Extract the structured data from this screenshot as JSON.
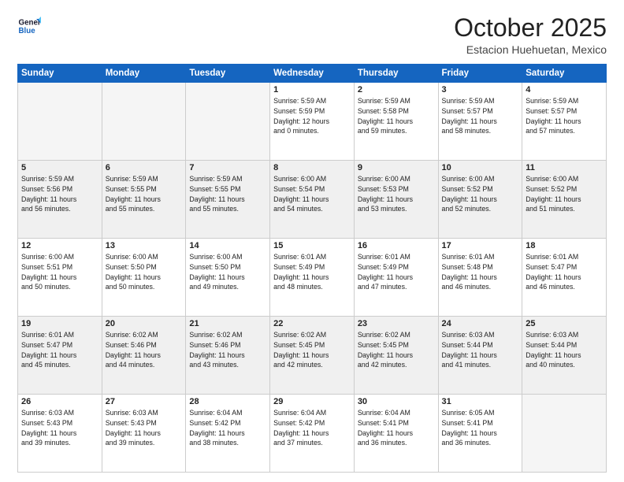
{
  "logo": {
    "line1": "General",
    "line2": "Blue"
  },
  "header": {
    "month": "October 2025",
    "location": "Estacion Huehuetan, Mexico"
  },
  "weekdays": [
    "Sunday",
    "Monday",
    "Tuesday",
    "Wednesday",
    "Thursday",
    "Friday",
    "Saturday"
  ],
  "weeks": [
    [
      {
        "day": "",
        "info": ""
      },
      {
        "day": "",
        "info": ""
      },
      {
        "day": "",
        "info": ""
      },
      {
        "day": "1",
        "info": "Sunrise: 5:59 AM\nSunset: 5:59 PM\nDaylight: 12 hours\nand 0 minutes."
      },
      {
        "day": "2",
        "info": "Sunrise: 5:59 AM\nSunset: 5:58 PM\nDaylight: 11 hours\nand 59 minutes."
      },
      {
        "day": "3",
        "info": "Sunrise: 5:59 AM\nSunset: 5:57 PM\nDaylight: 11 hours\nand 58 minutes."
      },
      {
        "day": "4",
        "info": "Sunrise: 5:59 AM\nSunset: 5:57 PM\nDaylight: 11 hours\nand 57 minutes."
      }
    ],
    [
      {
        "day": "5",
        "info": "Sunrise: 5:59 AM\nSunset: 5:56 PM\nDaylight: 11 hours\nand 56 minutes."
      },
      {
        "day": "6",
        "info": "Sunrise: 5:59 AM\nSunset: 5:55 PM\nDaylight: 11 hours\nand 55 minutes."
      },
      {
        "day": "7",
        "info": "Sunrise: 5:59 AM\nSunset: 5:55 PM\nDaylight: 11 hours\nand 55 minutes."
      },
      {
        "day": "8",
        "info": "Sunrise: 6:00 AM\nSunset: 5:54 PM\nDaylight: 11 hours\nand 54 minutes."
      },
      {
        "day": "9",
        "info": "Sunrise: 6:00 AM\nSunset: 5:53 PM\nDaylight: 11 hours\nand 53 minutes."
      },
      {
        "day": "10",
        "info": "Sunrise: 6:00 AM\nSunset: 5:52 PM\nDaylight: 11 hours\nand 52 minutes."
      },
      {
        "day": "11",
        "info": "Sunrise: 6:00 AM\nSunset: 5:52 PM\nDaylight: 11 hours\nand 51 minutes."
      }
    ],
    [
      {
        "day": "12",
        "info": "Sunrise: 6:00 AM\nSunset: 5:51 PM\nDaylight: 11 hours\nand 50 minutes."
      },
      {
        "day": "13",
        "info": "Sunrise: 6:00 AM\nSunset: 5:50 PM\nDaylight: 11 hours\nand 50 minutes."
      },
      {
        "day": "14",
        "info": "Sunrise: 6:00 AM\nSunset: 5:50 PM\nDaylight: 11 hours\nand 49 minutes."
      },
      {
        "day": "15",
        "info": "Sunrise: 6:01 AM\nSunset: 5:49 PM\nDaylight: 11 hours\nand 48 minutes."
      },
      {
        "day": "16",
        "info": "Sunrise: 6:01 AM\nSunset: 5:49 PM\nDaylight: 11 hours\nand 47 minutes."
      },
      {
        "day": "17",
        "info": "Sunrise: 6:01 AM\nSunset: 5:48 PM\nDaylight: 11 hours\nand 46 minutes."
      },
      {
        "day": "18",
        "info": "Sunrise: 6:01 AM\nSunset: 5:47 PM\nDaylight: 11 hours\nand 46 minutes."
      }
    ],
    [
      {
        "day": "19",
        "info": "Sunrise: 6:01 AM\nSunset: 5:47 PM\nDaylight: 11 hours\nand 45 minutes."
      },
      {
        "day": "20",
        "info": "Sunrise: 6:02 AM\nSunset: 5:46 PM\nDaylight: 11 hours\nand 44 minutes."
      },
      {
        "day": "21",
        "info": "Sunrise: 6:02 AM\nSunset: 5:46 PM\nDaylight: 11 hours\nand 43 minutes."
      },
      {
        "day": "22",
        "info": "Sunrise: 6:02 AM\nSunset: 5:45 PM\nDaylight: 11 hours\nand 42 minutes."
      },
      {
        "day": "23",
        "info": "Sunrise: 6:02 AM\nSunset: 5:45 PM\nDaylight: 11 hours\nand 42 minutes."
      },
      {
        "day": "24",
        "info": "Sunrise: 6:03 AM\nSunset: 5:44 PM\nDaylight: 11 hours\nand 41 minutes."
      },
      {
        "day": "25",
        "info": "Sunrise: 6:03 AM\nSunset: 5:44 PM\nDaylight: 11 hours\nand 40 minutes."
      }
    ],
    [
      {
        "day": "26",
        "info": "Sunrise: 6:03 AM\nSunset: 5:43 PM\nDaylight: 11 hours\nand 39 minutes."
      },
      {
        "day": "27",
        "info": "Sunrise: 6:03 AM\nSunset: 5:43 PM\nDaylight: 11 hours\nand 39 minutes."
      },
      {
        "day": "28",
        "info": "Sunrise: 6:04 AM\nSunset: 5:42 PM\nDaylight: 11 hours\nand 38 minutes."
      },
      {
        "day": "29",
        "info": "Sunrise: 6:04 AM\nSunset: 5:42 PM\nDaylight: 11 hours\nand 37 minutes."
      },
      {
        "day": "30",
        "info": "Sunrise: 6:04 AM\nSunset: 5:41 PM\nDaylight: 11 hours\nand 36 minutes."
      },
      {
        "day": "31",
        "info": "Sunrise: 6:05 AM\nSunset: 5:41 PM\nDaylight: 11 hours\nand 36 minutes."
      },
      {
        "day": "",
        "info": ""
      }
    ]
  ]
}
